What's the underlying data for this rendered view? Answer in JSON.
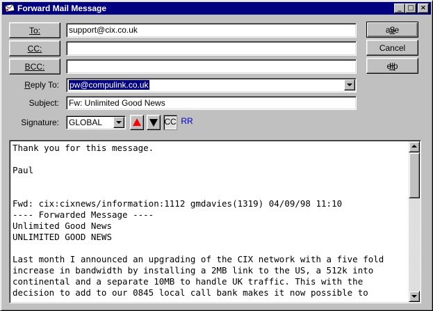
{
  "window": {
    "title": "Forward Mail Message",
    "controls": {
      "minimize": "_",
      "maximize": "□",
      "close": "×"
    }
  },
  "address": {
    "to_label": "To:",
    "to_value": "support@cix.co.uk",
    "cc_label": "CC:",
    "cc_value": "",
    "bcc_label": "BCC:",
    "bcc_value": "",
    "reply_to_label": "Reply To:",
    "reply_to_value": "pw@compulink.co.uk",
    "subject_label": "Subject:",
    "subject_value": "Fw: Unlimited Good News",
    "signature_label": "Signature:",
    "signature_value": "GLOBAL"
  },
  "actions": {
    "save_label": "Save",
    "cancel_label": "Cancel",
    "help_label": "Help"
  },
  "toolbar": {
    "cc_label": "CC",
    "rr_label": "RR",
    "colors": {
      "up_arrow": "#ff0000",
      "down_arrow": "#000000",
      "rr_text": "#0000c0",
      "title_bar": "#000080"
    }
  },
  "body": {
    "text": "Thank you for this message.\n\nPaul\n\n\nFwd: cix:cixnews/information:1112 gmdavies(1319) 04/09/98 11:10\n---- Forwarded Message ----\nUnlimited Good News\nUNLIMITED GOOD NEWS\n\nLast month I announced an upgrading of the CIX network with a five fold\nincrease in bandwidth by installing a 2MB link to the US, a 512k into\ncontinental and a separate 10MB to handle UK traffic. This with the\ndecision to add to our 0845 local call bank makes it now possible to"
  }
}
